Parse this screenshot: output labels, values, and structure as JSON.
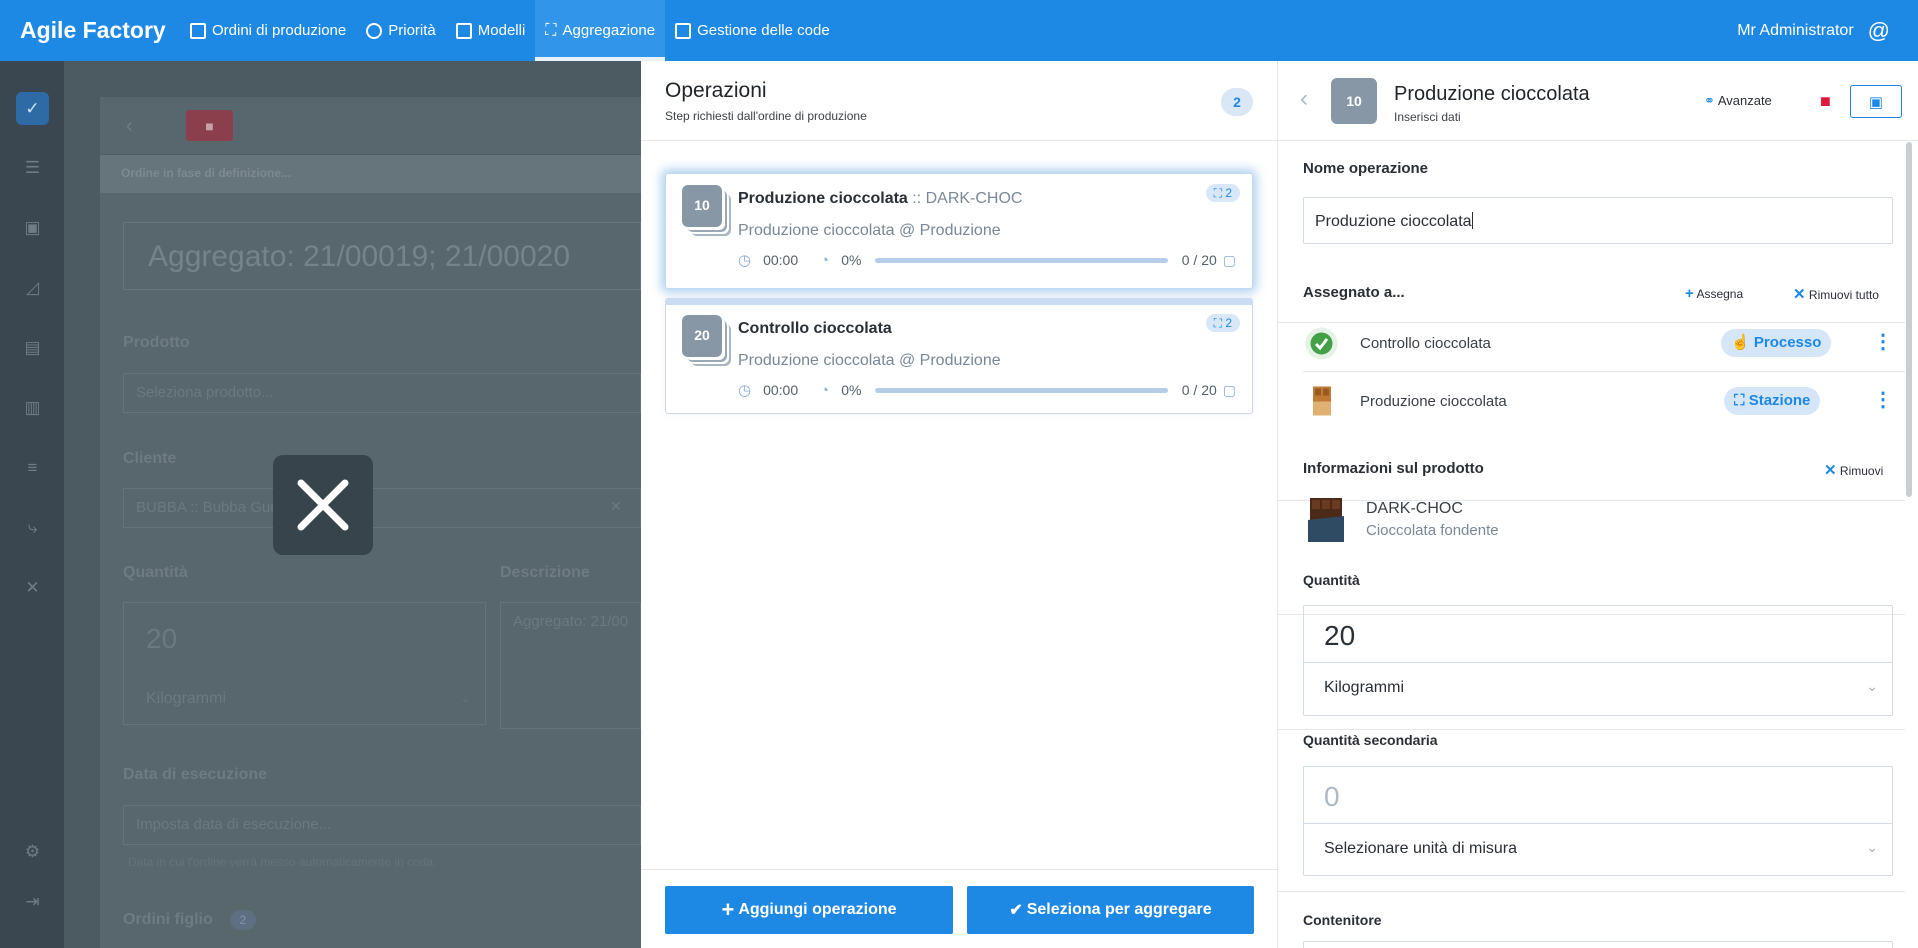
{
  "topbar": {
    "brand": "Agile Factory",
    "nav": [
      {
        "label": "Ordini di produzione",
        "icon": "orders-icon"
      },
      {
        "label": "Priorità",
        "icon": "priority-icon"
      },
      {
        "label": "Modelli",
        "icon": "models-icon"
      },
      {
        "label": "Aggregazione",
        "icon": "aggregation-icon",
        "active": true
      },
      {
        "label": "Gestione delle code",
        "icon": "queue-icon"
      }
    ],
    "user": "Mr Administrator",
    "accent": "#1e88e5"
  },
  "background_order": {
    "status": "Ordine in fase di definizione...",
    "title": "Aggregato: 21/00019; 21/00020",
    "product_label": "Prodotto",
    "product_placeholder": "Seleziona prodotto...",
    "client_label": "Cliente",
    "client_value": "BUBBA :: Bubba Gum",
    "quantity_label": "Quantità",
    "quantity_value": "20",
    "quantity_unit": "Kilogrammi",
    "description_label": "Descrizione",
    "description_value": "Aggregato: 21/00",
    "exec_date_label": "Data di esecuzione",
    "exec_date_placeholder": "Imposta data di esecuzione...",
    "exec_date_note": "Data in cui l'ordine verrà messo automaticamente in coda.",
    "child_orders_label": "Ordini figlio",
    "child_orders_count": "2"
  },
  "operations": {
    "title": "Operazioni",
    "subtitle": "Step richiesti dall'ordine di produzione",
    "count": "2",
    "items": [
      {
        "num": "10",
        "title": "Produzione cioccolata",
        "code": " :: DARK-CHOC",
        "badge": "2",
        "sub": "Produzione cioccolata @ Produzione",
        "time": "00:00",
        "percent": "0%",
        "progress": "0 / 20",
        "progress_fraction": 0
      },
      {
        "num": "20",
        "title": "Controllo cioccolata",
        "code": "",
        "badge": "2",
        "sub": "Produzione cioccolata @ Produzione",
        "time": "00:00",
        "percent": "0%",
        "progress": "0 / 20",
        "progress_fraction": 0
      }
    ],
    "add_button": "Aggiungi operazione",
    "select_button": "Seleziona per aggregare"
  },
  "detail": {
    "num": "10",
    "title": "Produzione cioccolata",
    "subtitle": "Inserisci dati",
    "advanced": "Avanzate",
    "name_label": "Nome operazione",
    "name_value": "Produzione cioccolata",
    "assigned_label": "Assegnato a...",
    "assign_action": "Assegna",
    "remove_all_action": "Rimuovi tutto",
    "assignments": [
      {
        "name": "Controllo cioccolata",
        "tag": "Processo",
        "icon": "check-process-icon"
      },
      {
        "name": "Produzione cioccolata",
        "tag": "Stazione",
        "icon": "chocolate-station-icon"
      }
    ],
    "product_info_label": "Informazioni sul prodotto",
    "remove_action": "Rimuovi",
    "product_code": "DARK-CHOC",
    "product_desc": "Cioccolata fondente",
    "qty_label": "Quantità",
    "qty_value": "20",
    "qty_unit": "Kilogrammi",
    "qty2_label": "Quantità secondaria",
    "qty2_placeholder": "0",
    "qty2_unit": "Selezionare unità di misura",
    "container_label": "Contenitore"
  }
}
